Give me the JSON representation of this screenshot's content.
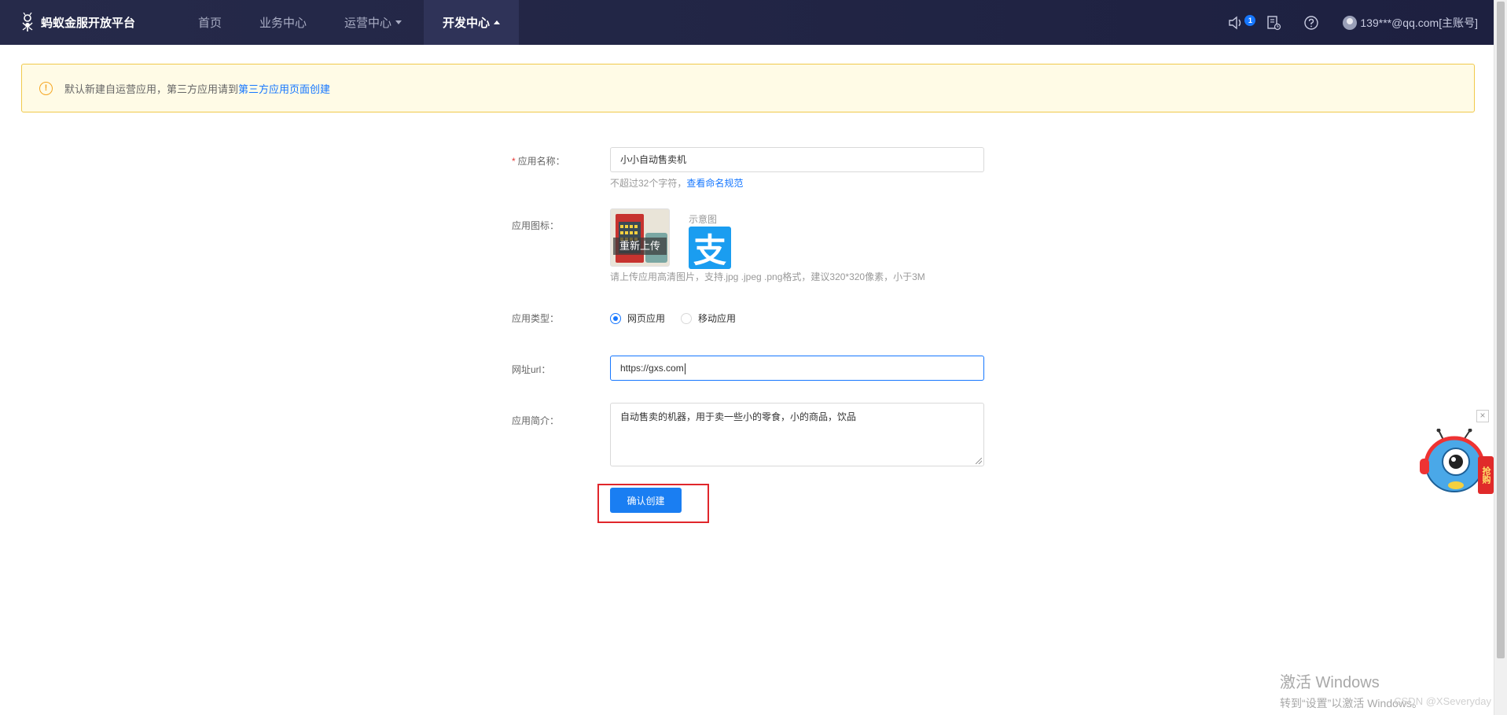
{
  "header": {
    "logo_text": "蚂蚁金服开放平台",
    "nav": [
      {
        "label": "首页"
      },
      {
        "label": "业务中心"
      },
      {
        "label": "运营中心"
      },
      {
        "label": "开发中心"
      }
    ],
    "notification_count": "1",
    "user_label": "139***@qq.com[主账号]"
  },
  "notice": {
    "text": "默认新建自运营应用，第三方应用请到",
    "link": "第三方应用页面创建"
  },
  "form": {
    "name_label": "应用名称：",
    "name_value": "小小自动售卖机",
    "name_hint": "不超过32个字符，",
    "name_hint_link": "查看命名规范",
    "icon_label": "应用图标：",
    "reupload_label": "重新上传",
    "sample_label": "示意图",
    "sample_glyph": "支",
    "icon_hint": "请上传应用高清图片，支持.jpg .jpeg .png格式，建议320*320像素，小于3M",
    "type_label": "应用类型：",
    "type_options": [
      {
        "label": "网页应用",
        "selected": true
      },
      {
        "label": "移动应用",
        "selected": false
      }
    ],
    "url_label": "网址url：",
    "url_value": "https://gxs.com",
    "desc_label": "应用简介：",
    "desc_value": "自动售卖的机器，用于卖一些小的零食，小的商品，饮品",
    "submit_label": "确认创建"
  },
  "floating": {
    "close_glyph": "×",
    "buy_label": "抢购"
  },
  "watermark": {
    "line1": "激活 Windows",
    "line2": "转到“设置”以激活 Windows。",
    "blog": "CSDN @XSeveryday"
  },
  "colors": {
    "header_bg": "#262a4a",
    "accent": "#1677ff",
    "notice_bg": "#fffbe6",
    "notice_border": "#f0c94a",
    "highlight_box": "#e0262b"
  }
}
